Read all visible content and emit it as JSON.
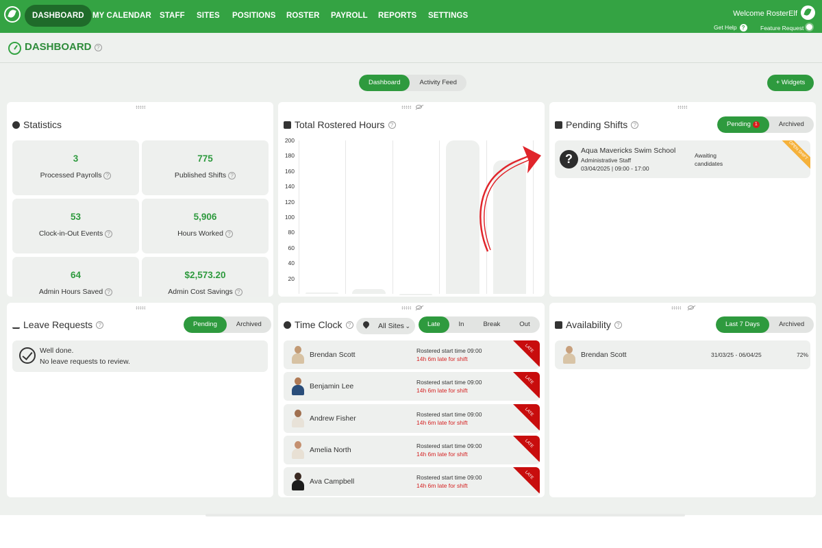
{
  "nav": {
    "items": [
      "DASHBOARD",
      "MY CALENDAR",
      "STAFF",
      "SITES",
      "POSITIONS",
      "ROSTER",
      "PAYROLL",
      "REPORTS",
      "SETTINGS"
    ],
    "welcome": "Welcome RosterElf",
    "get_help": "Get Help",
    "feature_request": "Feature Request"
  },
  "header": {
    "title": "DASHBOARD",
    "tabs": [
      "Dashboard",
      "Activity Feed"
    ],
    "widgets_button": "+ Widgets"
  },
  "statistics": {
    "title": "Statistics",
    "items": [
      {
        "value": "3",
        "label": "Processed Payrolls"
      },
      {
        "value": "775",
        "label": "Published Shifts"
      },
      {
        "value": "53",
        "label": "Clock-in-Out Events"
      },
      {
        "value": "5,906",
        "label": "Hours Worked"
      },
      {
        "value": "64",
        "label": "Admin Hours Saved"
      },
      {
        "value": "$2,573.20",
        "label": "Admin Cost Savings"
      }
    ]
  },
  "rostered_hours": {
    "title": "Total Rostered Hours"
  },
  "chart_data": {
    "type": "bar",
    "title": "Total Rostered Hours",
    "yticks": [
      "200",
      "180",
      "160",
      "140",
      "120",
      "100",
      "80",
      "60",
      "40",
      "20"
    ],
    "ylim": [
      0,
      200
    ],
    "values": [
      2,
      6,
      0,
      200,
      174
    ],
    "grid": true
  },
  "pending_shifts": {
    "title": "Pending Shifts",
    "tabs": [
      "Pending",
      "Archived"
    ],
    "badge": "1",
    "card": {
      "site": "Aqua Mavericks Swim School",
      "position": "Administrative Staff",
      "time": "03/04/2025 | 09:00 - 17:00",
      "status_line1": "Awaiting",
      "status_line2": "candidates",
      "ribbon": "OPEN SHIFT"
    }
  },
  "leave": {
    "title": "Leave Requests",
    "tabs": [
      "Pending",
      "Archived"
    ],
    "message_line1": "Well done.",
    "message_line2": "No leave requests to review."
  },
  "time_clock": {
    "title": "Time Clock",
    "sites_select": "All Sites",
    "tabs": [
      "Late",
      "In",
      "Break",
      "Out"
    ],
    "rows": [
      {
        "name": "Brendan Scott",
        "line1": "Rostered start time 09:00",
        "line2": "14h 6m late for shift",
        "tag": "LATE"
      },
      {
        "name": "Benjamin Lee",
        "line1": "Rostered start time 09:00",
        "line2": "14h 6m late for shift",
        "tag": "LATE"
      },
      {
        "name": "Andrew Fisher",
        "line1": "Rostered start time 09:00",
        "line2": "14h 6m late for shift",
        "tag": "LATE"
      },
      {
        "name": "Amelia North",
        "line1": "Rostered start time 09:00",
        "line2": "14h 6m late for shift",
        "tag": "LATE"
      },
      {
        "name": "Ava Campbell",
        "line1": "Rostered start time 09:00",
        "line2": "14h 6m late for shift",
        "tag": "LATE"
      }
    ]
  },
  "availability": {
    "title": "Availability",
    "tabs": [
      "Last 7 Days",
      "Archived"
    ],
    "rows": [
      {
        "name": "Brendan Scott",
        "range": "31/03/25 - 06/04/25",
        "percent": "72%"
      }
    ]
  },
  "colors": {
    "brand": "#34a343",
    "accent_dark": "#1f6b2a",
    "late": "#c80d0d",
    "annotation_arrow": "#e0252b"
  }
}
